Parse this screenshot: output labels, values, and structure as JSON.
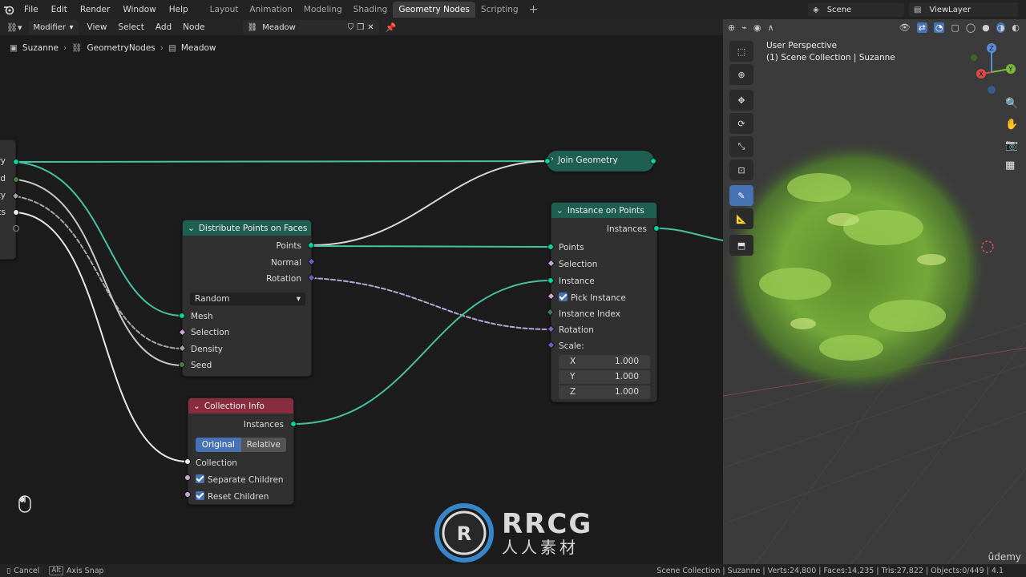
{
  "menu": {
    "items": [
      "File",
      "Edit",
      "Render",
      "Window",
      "Help"
    ]
  },
  "workspaces": {
    "tabs": [
      "Layout",
      "Animation",
      "Modeling",
      "Shading",
      "Geometry Nodes",
      "Scripting"
    ],
    "active": "Geometry Nodes"
  },
  "scene": {
    "name": "Scene",
    "view_layer": "ViewLayer"
  },
  "editor_header": {
    "mode": "Modifier",
    "menus": [
      "View",
      "Select",
      "Add",
      "Node"
    ],
    "node_group": "Meadow"
  },
  "breadcrumb": {
    "object": "Suzanne",
    "modifier": "GeometryNodes",
    "group": "Meadow"
  },
  "group_input": {
    "partial_labels": [
      "ry",
      "ed",
      "ty",
      "ts"
    ]
  },
  "nodes": {
    "join_geometry": {
      "title": "Join Geometry"
    },
    "distribute": {
      "title": "Distribute Points on Faces",
      "outputs": [
        "Points",
        "Normal",
        "Rotation"
      ],
      "mode": "Random",
      "inputs": [
        "Mesh",
        "Selection",
        "Density",
        "Seed"
      ]
    },
    "instance_on_points": {
      "title": "Instance on Points",
      "output": "Instances",
      "inputs": [
        "Points",
        "Selection",
        "Instance",
        "Pick Instance",
        "Instance Index",
        "Rotation",
        "Scale:"
      ],
      "scale": [
        {
          "axis": "X",
          "value": "1.000"
        },
        {
          "axis": "Y",
          "value": "1.000"
        },
        {
          "axis": "Z",
          "value": "1.000"
        }
      ]
    },
    "collection_info": {
      "title": "Collection Info",
      "output": "Instances",
      "modes": [
        "Original",
        "Relative"
      ],
      "active_mode": "Original",
      "inputs": [
        "Collection",
        "Separate Children",
        "Reset Children"
      ]
    }
  },
  "viewport": {
    "title": "User Perspective",
    "subtitle": "(1) Scene Collection | Suzanne",
    "gizmo_axes": [
      "X",
      "Y",
      "Z"
    ]
  },
  "status": {
    "left": [
      {
        "key": "Cancel"
      },
      {
        "key": "Alt",
        "label": "Axis Snap"
      }
    ],
    "right": "Scene Collection | Suzanne | Verts:24,800 | Faces:14,235 | Tris:27,822 | Objects:0/449 | 4.1"
  },
  "watermark": {
    "brand": "RRCG",
    "sub": "人人素材",
    "corner": "ûdemy"
  },
  "colors": {
    "geometry_socket": "#00d6a3",
    "geo_header": "#1f5f52",
    "collection_header": "#8a2c3f",
    "accent": "#4772b3"
  }
}
